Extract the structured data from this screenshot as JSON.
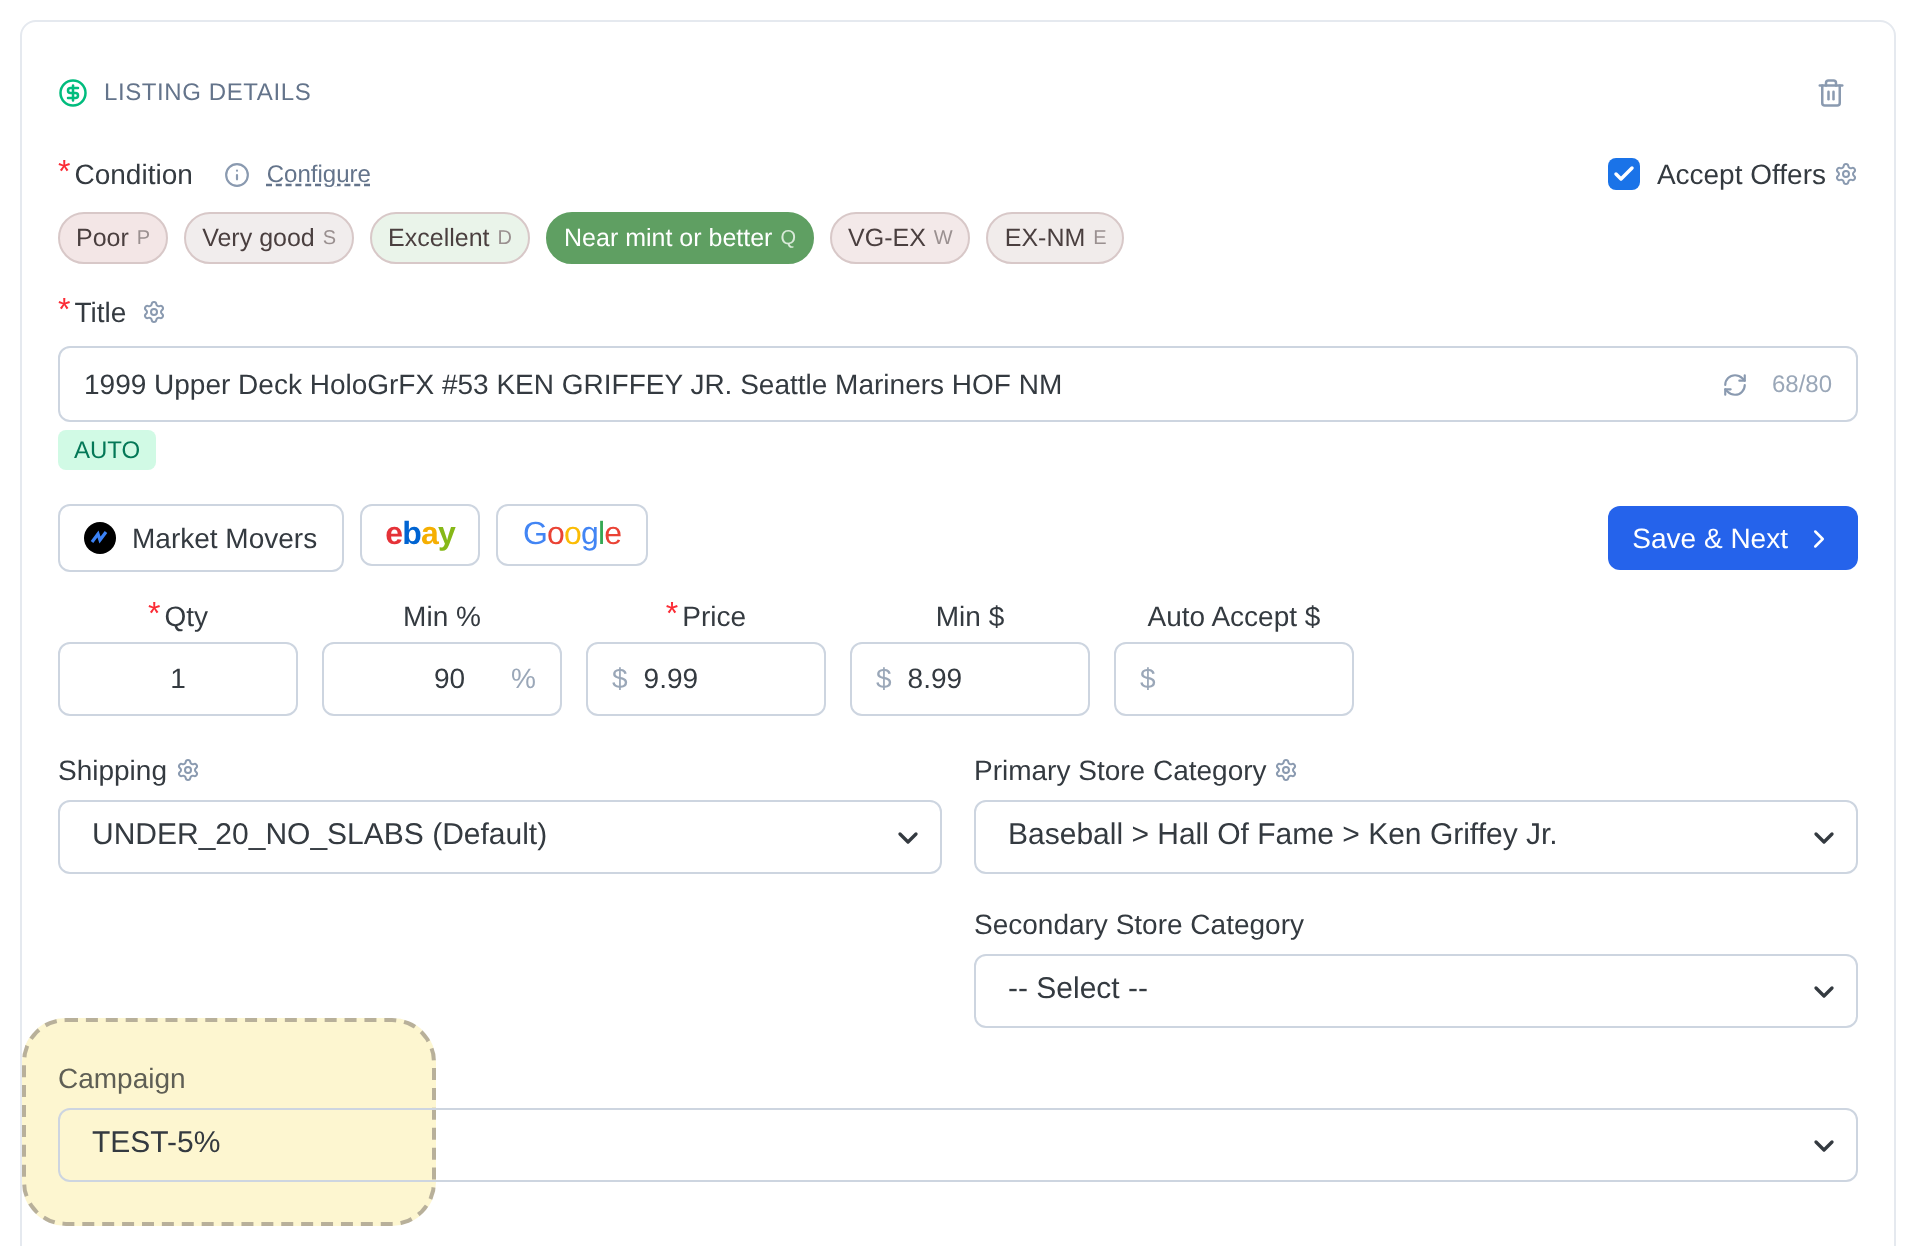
{
  "section": {
    "title": "LISTING DETAILS"
  },
  "condition": {
    "label": "Condition",
    "required_mark": "*",
    "configure_link": "Configure",
    "options": [
      {
        "label": "Poor",
        "key": "P",
        "selected": false,
        "color": "#f3e6e6"
      },
      {
        "label": "Very good",
        "key": "S",
        "selected": false,
        "color": "#f1eded"
      },
      {
        "label": "Excellent",
        "key": "D",
        "selected": false,
        "color": "#eaf4ea"
      },
      {
        "label": "Near mint or better",
        "key": "Q",
        "selected": true,
        "color": "#5f9f62"
      },
      {
        "label": "VG-EX",
        "key": "W",
        "selected": false,
        "color": "#f3e9e9"
      },
      {
        "label": "EX-NM",
        "key": "E",
        "selected": false,
        "color": "#f1eceb"
      }
    ]
  },
  "accept_offers": {
    "label": "Accept Offers",
    "checked": true
  },
  "title_field": {
    "label": "Title",
    "required_mark": "*",
    "value": "1999 Upper Deck HoloGrFX #53 KEN GRIFFEY JR. Seattle Mariners HOF NM",
    "counter": "68/80",
    "badge": "AUTO"
  },
  "lookup_buttons": [
    {
      "kind": "marketmovers",
      "label": "Market Movers"
    },
    {
      "kind": "ebay",
      "label": "ebay"
    },
    {
      "kind": "google",
      "label": "Google"
    }
  ],
  "save_button": "Save & Next",
  "price_fields": [
    {
      "label": "Qty",
      "required_mark": "*",
      "value": "1",
      "kind": "center"
    },
    {
      "label": "Min %",
      "value": "90",
      "suffix": "%",
      "kind": "suffix"
    },
    {
      "label": "Price",
      "required_mark": "*",
      "prefix": "$",
      "value": "9.99",
      "kind": "prefix"
    },
    {
      "label": "Min $",
      "prefix": "$",
      "value": "8.99",
      "kind": "prefix"
    },
    {
      "label": "Auto Accept $",
      "prefix": "$",
      "kind": "prefix"
    }
  ],
  "shipping": {
    "label": "Shipping",
    "value": "UNDER_20_NO_SLABS (Default)"
  },
  "primary_category": {
    "label": "Primary Store Category",
    "value": "Baseball > Hall Of Fame > Ken Griffey Jr."
  },
  "secondary_category": {
    "label": "Secondary Store Category",
    "value": "-- Select --"
  },
  "campaign": {
    "label": "Campaign",
    "value": "TEST-5%"
  }
}
